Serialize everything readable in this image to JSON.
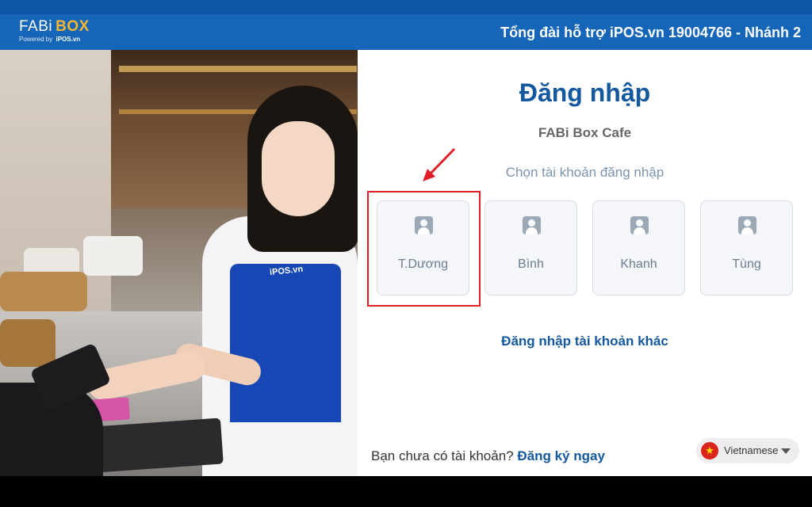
{
  "header": {
    "logo_primary": "FABi",
    "logo_accent": "BOX",
    "powered_by": "Powered by",
    "powered_brand": "iPOS.vn",
    "hotline": "Tổng đài hỗ trợ iPOS.vn 19004766 - Nhánh 2"
  },
  "photo": {
    "apron_text": "iPOS.vn"
  },
  "login": {
    "title": "Đăng nhập",
    "store_name": "FABi Box Cafe",
    "choose_prompt": "Chọn tài khoản đăng nhập",
    "accounts": [
      {
        "name": "T.Dương",
        "icon": "user-avatar-icon"
      },
      {
        "name": "Bình",
        "icon": "user-avatar-icon"
      },
      {
        "name": "Khanh",
        "icon": "user-avatar-icon"
      },
      {
        "name": "Tùng",
        "icon": "user-avatar-icon"
      }
    ],
    "other_account_link": "Đăng nhập tài khoản khác",
    "no_account_text": "Bạn chưa có tài khoản?",
    "signup_link": "Đăng ký ngay"
  },
  "language": {
    "selected": "Vietnamese",
    "flag_icon": "vietnam-flag-icon",
    "flag_star": "★"
  },
  "colors": {
    "header_bg": "#1565b8",
    "accent": "#14589e",
    "logo_accent": "#f7b731",
    "highlight": "#e01f26"
  }
}
